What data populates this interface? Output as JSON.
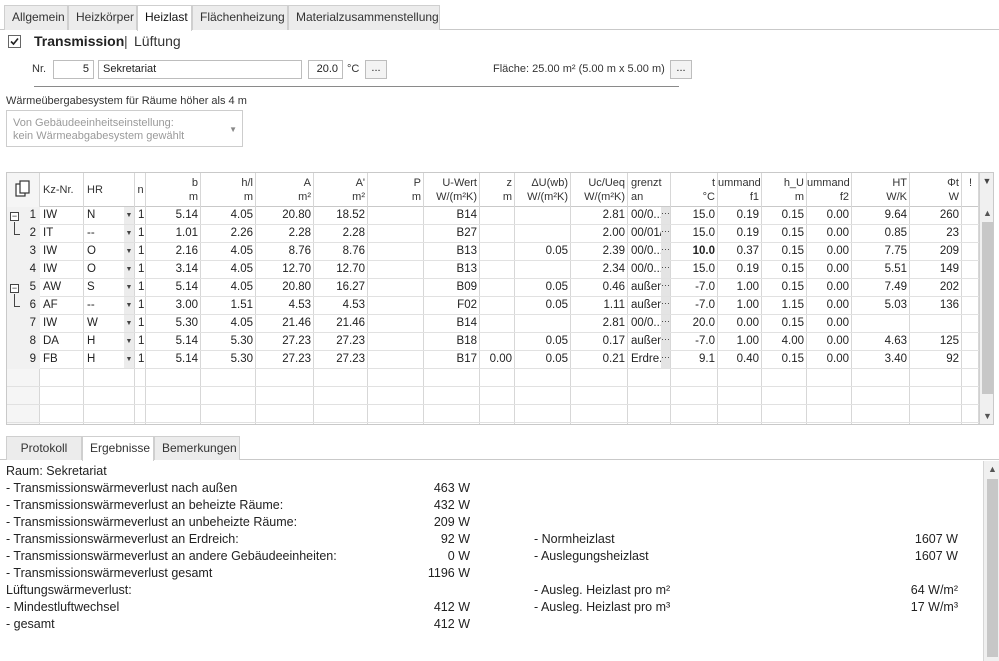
{
  "tabs": [
    "Allgemein",
    "Heizkörper",
    "Heizlast",
    "Flächenheizung",
    "Materialzusammenstellung"
  ],
  "active_tab": "Heizlast",
  "mode": {
    "transmission": "Transmission",
    "separator": "|",
    "lueftung": "Lüftung"
  },
  "room": {
    "nr_label": "Nr.",
    "nr": "5",
    "name": "Sekretariat",
    "temp": "20.0",
    "temp_unit": "°C",
    "more": "...",
    "flaeche_label": "Fläche: 25.00  m² (5.00 m x 5.00 m)"
  },
  "waerme": {
    "label": "Wärmeübergabesystem für Räume höher als 4 m",
    "line1": "Von Gebäudeeinheitseinstellung:",
    "line2": "kein Wärmeabgabesystem gewählt"
  },
  "grid": {
    "headers": [
      {
        "top": "",
        "bot": ""
      },
      {
        "top": "Kz-Nr.",
        "bot": ""
      },
      {
        "top": "HR",
        "bot": ""
      },
      {
        "top": "n",
        "bot": ""
      },
      {
        "top": "b",
        "bot": "m"
      },
      {
        "top": "h/l",
        "bot": "m"
      },
      {
        "top": "A",
        "bot": "m²"
      },
      {
        "top": "A'",
        "bot": "m²"
      },
      {
        "top": "P",
        "bot": "m"
      },
      {
        "top": "U-Wert",
        "bot": "W/(m²K)"
      },
      {
        "top": "z",
        "bot": "m"
      },
      {
        "top": "ΔU(wb)",
        "bot": "W/(m²K)"
      },
      {
        "top": "Uc/Ueq",
        "bot": "W/(m²K)"
      },
      {
        "top": "grenzt",
        "bot": "an"
      },
      {
        "top": "t",
        "bot": "°C"
      },
      {
        "top": "ummand",
        "bot": "f1"
      },
      {
        "top": "h_U",
        "bot": "m"
      },
      {
        "top": "ummand",
        "bot": "f2"
      },
      {
        "top": "HT",
        "bot": "W/K"
      },
      {
        "top": "Φt",
        "bot": "W"
      },
      {
        "top": "!",
        "bot": ""
      }
    ],
    "rows": [
      [
        "1",
        "IW",
        "N",
        "1",
        "5.14",
        "4.05",
        "20.80",
        "18.52",
        "",
        "B14",
        "",
        "",
        "2.81",
        "00/0...",
        "15.0",
        "0.19",
        "0.15",
        "0.00",
        "9.64",
        "260"
      ],
      [
        "2",
        "IT",
        "--",
        "1",
        "1.01",
        "2.26",
        "2.28",
        "2.28",
        "",
        "B27",
        "",
        "",
        "2.00",
        "00/01/...",
        "15.0",
        "0.19",
        "0.15",
        "0.00",
        "0.85",
        "23"
      ],
      [
        "3",
        "IW",
        "O",
        "1",
        "2.16",
        "4.05",
        "8.76",
        "8.76",
        "",
        "B13",
        "",
        "0.05",
        "2.39",
        "00/0...",
        "10.0",
        "0.37",
        "0.15",
        "0.00",
        "7.75",
        "209"
      ],
      [
        "4",
        "IW",
        "O",
        "1",
        "3.14",
        "4.05",
        "12.70",
        "12.70",
        "",
        "B13",
        "",
        "",
        "2.34",
        "00/0...",
        "15.0",
        "0.19",
        "0.15",
        "0.00",
        "5.51",
        "149"
      ],
      [
        "5",
        "AW",
        "S",
        "1",
        "5.14",
        "4.05",
        "20.80",
        "16.27",
        "",
        "B09",
        "",
        "0.05",
        "0.46",
        "außen",
        "-7.0",
        "1.00",
        "0.15",
        "0.00",
        "7.49",
        "202"
      ],
      [
        "6",
        "AF",
        "--",
        "1",
        "3.00",
        "1.51",
        "4.53",
        "4.53",
        "",
        "F02",
        "",
        "0.05",
        "1.11",
        "außen",
        "-7.0",
        "1.00",
        "1.15",
        "0.00",
        "5.03",
        "136"
      ],
      [
        "7",
        "IW",
        "W",
        "1",
        "5.30",
        "4.05",
        "21.46",
        "21.46",
        "",
        "B14",
        "",
        "",
        "2.81",
        "00/0...",
        "20.0",
        "0.00",
        "0.15",
        "0.00",
        "",
        ""
      ],
      [
        "8",
        "DA",
        "H",
        "1",
        "5.14",
        "5.30",
        "27.23",
        "27.23",
        "",
        "B18",
        "",
        "0.05",
        "0.17",
        "außen",
        "-7.0",
        "1.00",
        "4.00",
        "0.00",
        "4.63",
        "125"
      ],
      [
        "9",
        "FB",
        "H",
        "1",
        "5.14",
        "5.30",
        "27.23",
        "27.23",
        "",
        "B17",
        "0.00",
        "0.05",
        "0.21",
        "Erdre...",
        "9.1",
        "0.40",
        "0.15",
        "0.00",
        "3.40",
        "92"
      ]
    ]
  },
  "bottom_tabs": [
    "Protokoll",
    "Ergebnisse",
    "Bemerkungen"
  ],
  "active_bottom_tab": "Ergebnisse",
  "results": {
    "room_line": "Raum: Sekretariat",
    "left": [
      {
        "label": "- Transmissionswärmeverlust nach außen",
        "value": "463 W"
      },
      {
        "label": "- Transmissionswärmeverlust an beheizte Räume:",
        "value": "432 W"
      },
      {
        "label": "- Transmissionswärmeverlust an unbeheizte Räume:",
        "value": "209 W"
      },
      {
        "label": "- Transmissionswärmeverlust an Erdreich:",
        "value": "92 W"
      },
      {
        "label": "- Transmissionswärmeverlust an andere Gebäudeeinheiten:",
        "value": "0 W"
      },
      {
        "label": "- Transmissionswärmeverlust gesamt",
        "value": "1196 W"
      },
      {
        "label": "Lüftungswärmeverlust:",
        "value": ""
      },
      {
        "label": "- Mindestluftwechsel",
        "value": "412 W"
      },
      {
        "label": "- gesamt",
        "value": "412 W"
      }
    ],
    "right": [
      {
        "label": "- Normheizlast",
        "value": "1607 W"
      },
      {
        "label": "- Auslegungsheizlast",
        "value": "1607 W"
      },
      {
        "label": "- Ausleg. Heizlast pro m²",
        "value": "64 W/m²"
      },
      {
        "label": "- Ausleg. Heizlast pro m³",
        "value": "17 W/m³"
      }
    ]
  }
}
